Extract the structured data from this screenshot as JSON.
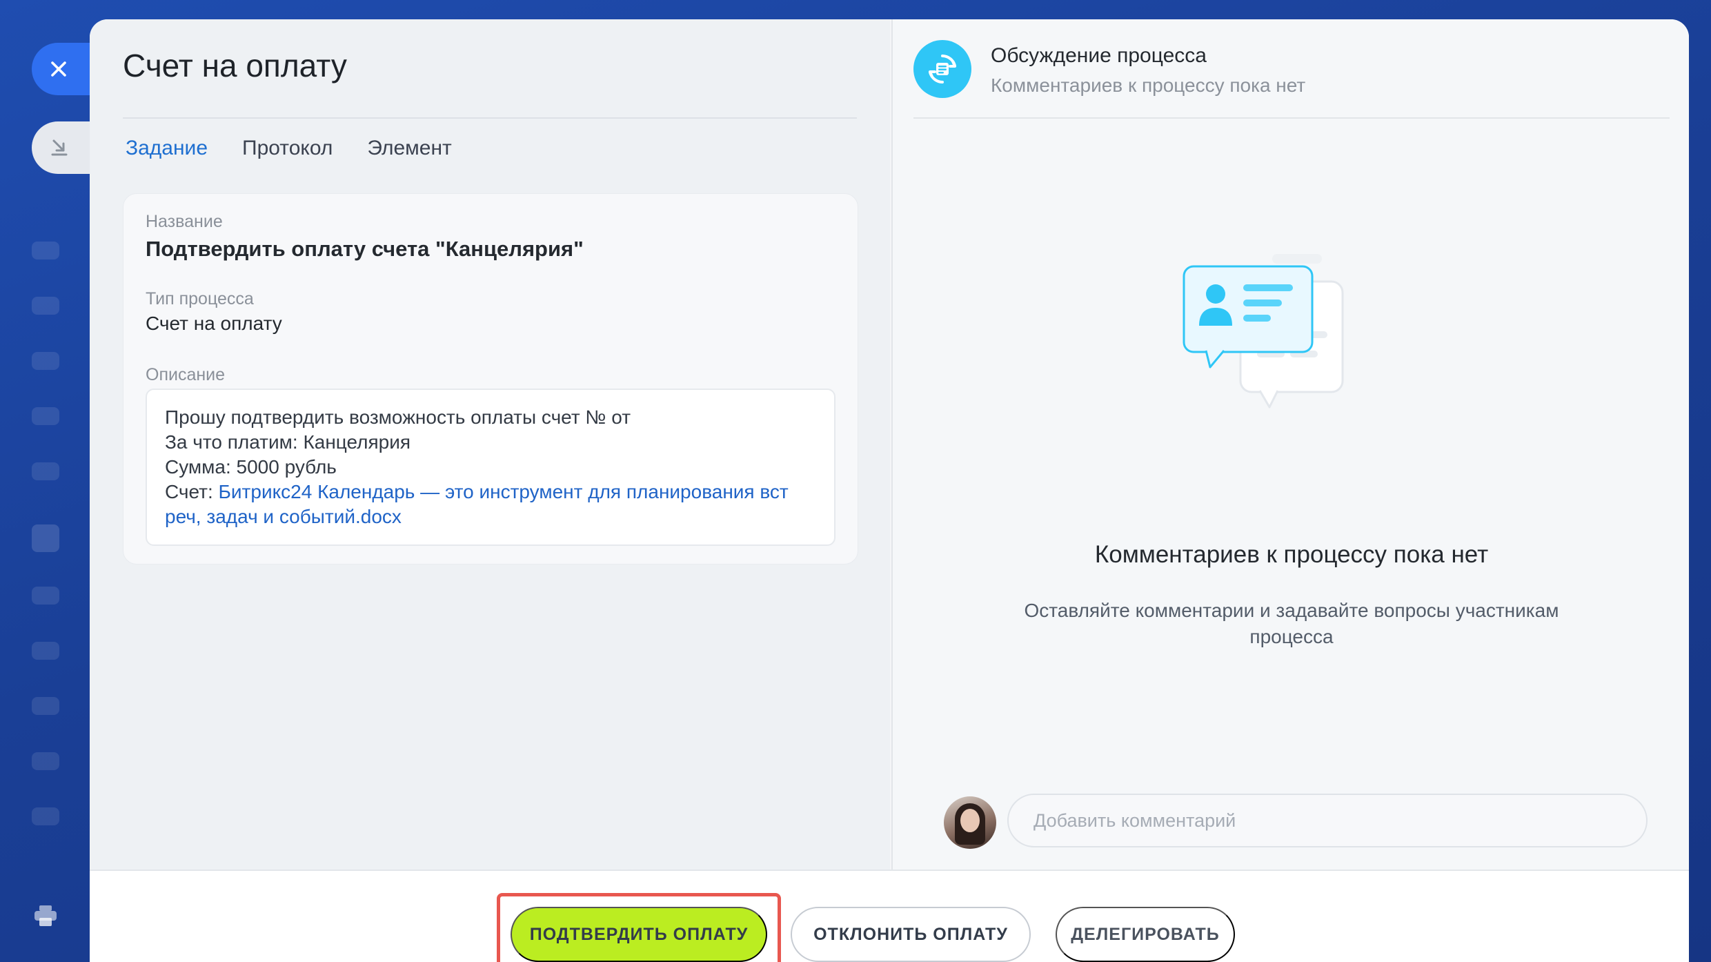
{
  "window": {
    "title": "Счет на оплату"
  },
  "tabs": [
    {
      "label": "Задание",
      "active": true
    },
    {
      "label": "Протокол",
      "active": false
    },
    {
      "label": "Элемент",
      "active": false
    }
  ],
  "task": {
    "name_label": "Название",
    "name_value": "Подтвердить оплату счета \"Канцелярия\"",
    "type_label": "Тип процесса",
    "type_value": "Счет на оплату",
    "desc_label": "Описание",
    "desc_line1": "Прошу подтвердить возможность оплаты счет № от",
    "desc_line2": "За что платим: Канцелярия",
    "desc_line3": "Сумма: 5000 рубль",
    "desc_line4_prefix": "Счет: ",
    "desc_link": "Битрикс24 Календарь — это инструмент для планирования вст реч, задач и событий.docx"
  },
  "discussion": {
    "title": "Обсуждение процесса",
    "subtitle": "Комментариев к процессу пока нет",
    "empty_title": "Комментариев к процессу пока нет",
    "empty_text": "Оставляйте комментарии и задавайте вопросы участникам процесса",
    "input_placeholder": "Добавить комментарий"
  },
  "footer": {
    "approve_label": "ПОДТВЕРДИТЬ ОПЛАТУ",
    "reject_label": "ОТКЛОНИТЬ ОПЛАТУ",
    "delegate_label": "ДЕЛЕГИРОВАТЬ"
  },
  "colors": {
    "accent": "#1e6fd0",
    "approve": "#bbed21",
    "highlight": "#e8574f",
    "discussion_icon": "#2fc6f6"
  },
  "icons": {
    "close": "close-icon",
    "collapse": "collapse-icon",
    "print": "print-icon",
    "discussion": "process-discussion-icon"
  }
}
